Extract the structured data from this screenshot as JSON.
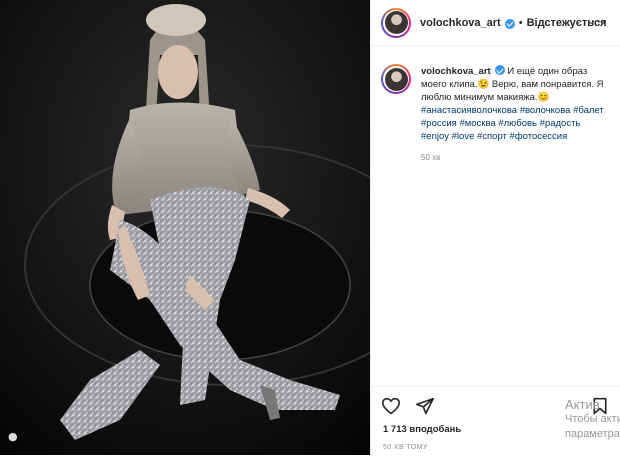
{
  "post": {
    "username": "volochkova_art",
    "follow_status": "Відстежується",
    "separator": "•",
    "more_icon": "more-horizontal-icon"
  },
  "comment": {
    "username": "volochkova_art",
    "caption": "И ещё один образ моего клипа.😉 Верю, вам понравится. Я люблю минимум макияжа.😊",
    "hashtags": [
      "#анастасияволочкова",
      "#волочкова",
      "#балет",
      "#россия",
      "#москва",
      "#любовь",
      "#радость",
      "#enjoy",
      "#love",
      "#спорт",
      "#фотосессия"
    ],
    "time_ago": "50 хв"
  },
  "actions": {
    "like_icon": "heart-icon",
    "share_icon": "send-icon",
    "save_icon": "bookmark-icon",
    "likes_text": "1 713 вподобань",
    "time_text": "50 ХВ ТОМУ"
  },
  "watermark": {
    "line1": "Актив",
    "line2": "Чтобы акти",
    "line3": "параметра"
  },
  "colors": {
    "verified": "#3897f0",
    "hashtag": "#00376b",
    "muted": "#8e8e8e"
  }
}
